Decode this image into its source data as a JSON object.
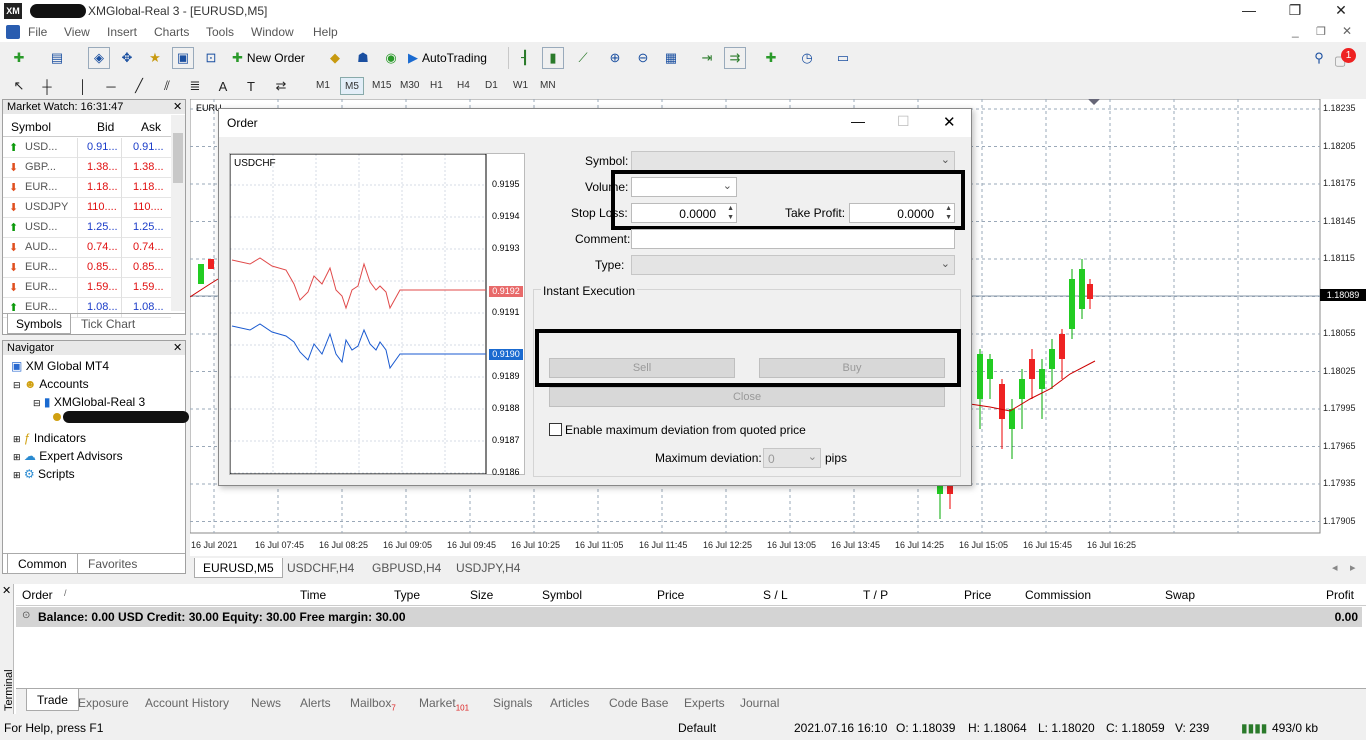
{
  "window": {
    "title": "XMGlobal-Real 3 - [EURUSD,M5]",
    "title_suffix": "XMGlobal-Real 3 - [EURUSD,M5]",
    "logo_text": "XM"
  },
  "menu": [
    "File",
    "View",
    "Insert",
    "Charts",
    "Tools",
    "Window",
    "Help"
  ],
  "toolbar": {
    "new_order": "New Order",
    "auto_trading": "AutoTrading",
    "timeframes": [
      "M1",
      "M5",
      "M15",
      "M30",
      "H1",
      "H4",
      "D1",
      "W1",
      "MN"
    ],
    "active_tf": "M5",
    "notification_count": "1"
  },
  "market_watch": {
    "title": "Market Watch: 16:31:47",
    "headers": {
      "symbol": "Symbol",
      "bid": "Bid",
      "ask": "Ask"
    },
    "rows": [
      {
        "symbol": "USD...",
        "bid": "0.91...",
        "ask": "0.91...",
        "dir": "up",
        "color": "#1a3cc8"
      },
      {
        "symbol": "GBP...",
        "bid": "1.38...",
        "ask": "1.38...",
        "dir": "dn",
        "color": "#e01010"
      },
      {
        "symbol": "EUR...",
        "bid": "1.18...",
        "ask": "1.18...",
        "dir": "dn",
        "color": "#e01010"
      },
      {
        "symbol": "USDJPY",
        "bid": "110....",
        "ask": "110....",
        "dir": "dn",
        "color": "#e01010"
      },
      {
        "symbol": "USD...",
        "bid": "1.25...",
        "ask": "1.25...",
        "dir": "up",
        "color": "#1a3cc8"
      },
      {
        "symbol": "AUD...",
        "bid": "0.74...",
        "ask": "0.74...",
        "dir": "dn",
        "color": "#e01010"
      },
      {
        "symbol": "EUR...",
        "bid": "0.85...",
        "ask": "0.85...",
        "dir": "dn",
        "color": "#e01010"
      },
      {
        "symbol": "EUR...",
        "bid": "1.59...",
        "ask": "1.59...",
        "dir": "dn",
        "color": "#e01010"
      },
      {
        "symbol": "EUR...",
        "bid": "1.08...",
        "ask": "1.08...",
        "dir": "up",
        "color": "#1a3cc8"
      }
    ],
    "tabs": [
      "Symbols",
      "Tick Chart"
    ]
  },
  "navigator": {
    "title": "Navigator",
    "root": "XM Global MT4",
    "accounts": "Accounts",
    "account": "XMGlobal-Real 3",
    "items": [
      "Indicators",
      "Expert Advisors",
      "Scripts"
    ],
    "tabs": [
      "Common",
      "Favorites"
    ]
  },
  "chart": {
    "corner_label": "EURU",
    "price_labels": [
      "1.18235",
      "1.18205",
      "1.18175",
      "1.18145",
      "1.18115",
      "1.18089",
      "1.18055",
      "1.18025",
      "1.17995",
      "1.17965",
      "1.17935",
      "1.17905"
    ],
    "current_price": "1.18089",
    "time_labels": [
      "16 Jul 2021",
      "16 Jul 07:45",
      "16 Jul 08:25",
      "16 Jul 09:05",
      "16 Jul 09:45",
      "16 Jul 10:25",
      "16 Jul 11:05",
      "16 Jul 11:45",
      "16 Jul 12:25",
      "16 Jul 13:05",
      "16 Jul 13:45",
      "16 Jul 14:25",
      "16 Jul 15:05",
      "16 Jul 15:45",
      "16 Jul 16:25"
    ],
    "tabs": [
      "EURUSD,M5",
      "USDCHF,H4",
      "GBPUSD,H4",
      "USDJPY,H4"
    ]
  },
  "order": {
    "title": "Order",
    "tick_symbol": "USDCHF",
    "tick_prices": [
      "0.9195",
      "0.9194",
      "0.9193",
      "0.9192",
      "0.9191",
      "0.9190",
      "0.9189",
      "0.9188",
      "0.9187",
      "0.9186"
    ],
    "ask_badge": "0.9192",
    "bid_badge": "0.9190",
    "symbol_label": "Symbol:",
    "volume_label": "Volume:",
    "stop_loss_label": "Stop Loss:",
    "stop_loss_value": "0.0000",
    "take_profit_label": "Take Profit:",
    "take_profit_value": "0.0000",
    "comment_label": "Comment:",
    "type_label": "Type:",
    "execution_label": "Instant Execution",
    "sell": "Sell",
    "buy": "Buy",
    "close": "Close",
    "deviation_checkbox": "Enable maximum deviation from quoted price",
    "max_deviation_label": "Maximum deviation:",
    "max_deviation_value": "0",
    "pips": "pips"
  },
  "terminal": {
    "side_label": "Terminal",
    "headers": [
      "Order",
      "Time",
      "Type",
      "Size",
      "Symbol",
      "Price",
      "S / L",
      "T / P",
      "Price",
      "Commission",
      "Swap",
      "Profit"
    ],
    "balance_line": "Balance: 0.00 USD  Credit: 30.00  Equity: 30.00  Free margin: 30.00",
    "balance_profit": "0.00",
    "tabs": [
      "Trade",
      "Exposure",
      "Account History",
      "News",
      "Alerts",
      "Mailbox",
      "Market",
      "Signals",
      "Articles",
      "Code Base",
      "Experts",
      "Journal"
    ],
    "mailbox_count": "7",
    "market_count": "101"
  },
  "status": {
    "help": "For Help, press F1",
    "profile": "Default",
    "datetime": "2021.07.16 16:10",
    "open": "O: 1.18039",
    "high": "H: 1.18064",
    "low": "L: 1.18020",
    "close": "C: 1.18059",
    "volume": "V: 239",
    "traffic": "493/0 kb"
  }
}
